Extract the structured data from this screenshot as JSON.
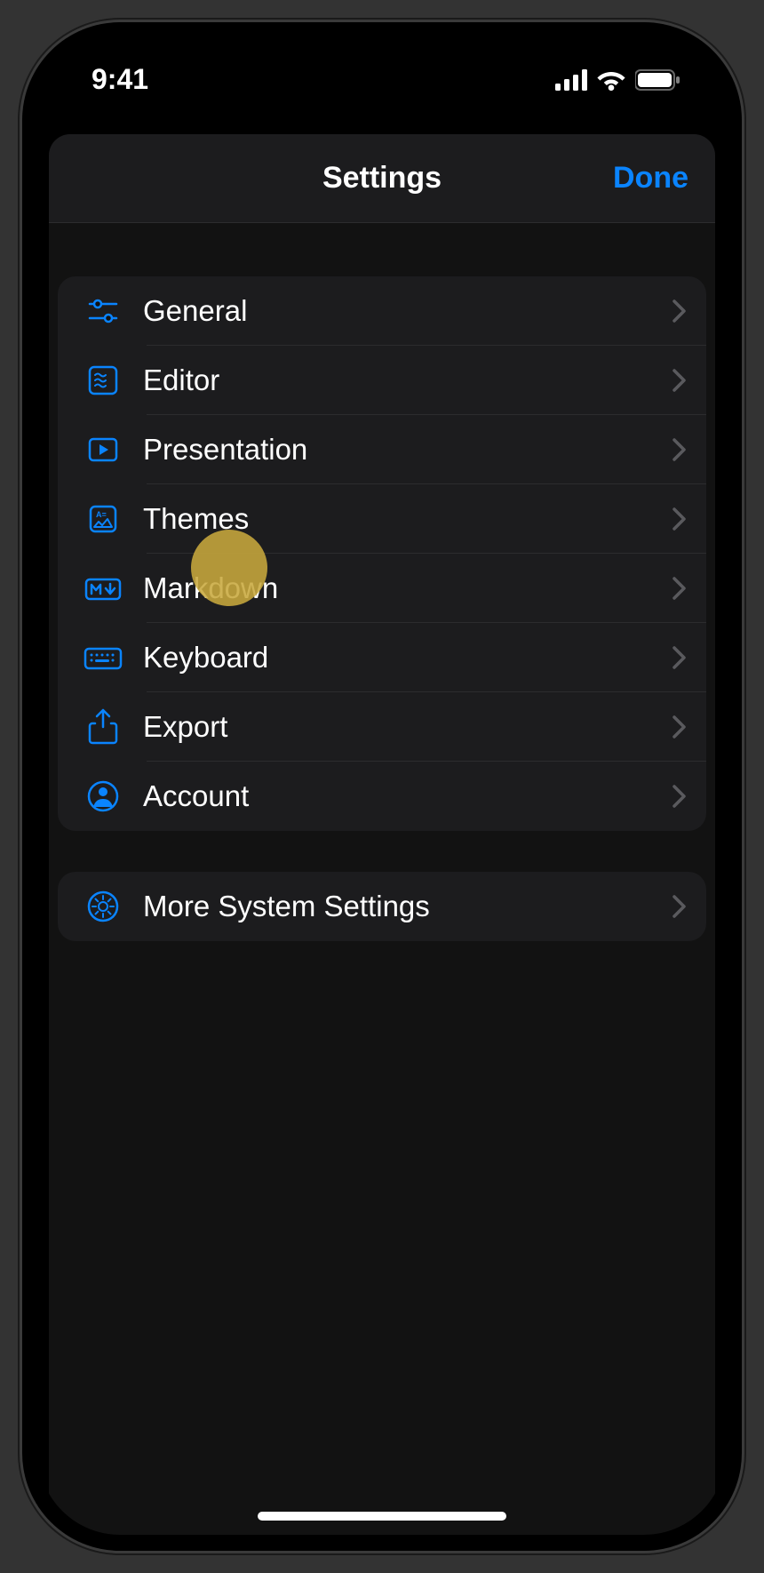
{
  "status": {
    "time": "9:41"
  },
  "nav": {
    "title": "Settings",
    "done": "Done"
  },
  "groups": [
    {
      "items": [
        {
          "icon": "sliders",
          "label": "General"
        },
        {
          "icon": "waves",
          "label": "Editor"
        },
        {
          "icon": "play",
          "label": "Presentation"
        },
        {
          "icon": "card",
          "label": "Themes"
        },
        {
          "icon": "markdown",
          "label": "Markdown"
        },
        {
          "icon": "keyboard",
          "label": "Keyboard"
        },
        {
          "icon": "share",
          "label": "Export"
        },
        {
          "icon": "person",
          "label": "Account"
        }
      ]
    },
    {
      "items": [
        {
          "icon": "gear",
          "label": "More System Settings"
        }
      ]
    }
  ]
}
